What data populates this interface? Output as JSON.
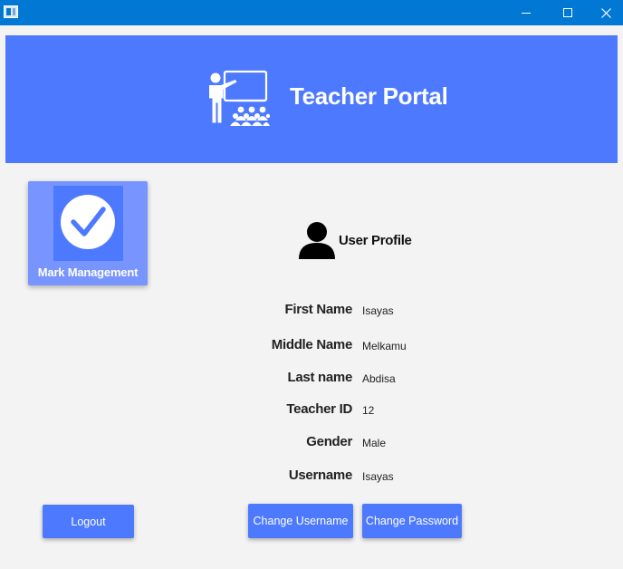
{
  "window": {
    "controls": {
      "minimize": "minimize-icon",
      "maximize": "maximize-icon",
      "close": "close-icon"
    }
  },
  "header": {
    "title": "Teacher Portal",
    "icon": "teacher-presentation-icon",
    "background": "#4d79ff"
  },
  "sidebar": {
    "mark_management_label": "Mark Management",
    "icon": "checkmark-icon"
  },
  "profile": {
    "title": "User Profile",
    "icon": "user-icon",
    "fields": [
      {
        "label": "First Name",
        "value": "Isayas"
      },
      {
        "label": "Middle Name",
        "value": "Melkamu"
      },
      {
        "label": "Last name",
        "value": "Abdisa"
      },
      {
        "label": "Teacher ID",
        "value": "12"
      },
      {
        "label": "Gender",
        "value": "Male"
      },
      {
        "label": "Username",
        "value": "Isayas"
      }
    ]
  },
  "actions": {
    "logout_label": "Logout",
    "change_username_label": "Change Username",
    "change_password_label": "Change Password"
  },
  "colors": {
    "titlebar": "#0078d4",
    "accent": "#4d79ff",
    "tile": "#7894ff",
    "background": "#f3f3f3"
  }
}
